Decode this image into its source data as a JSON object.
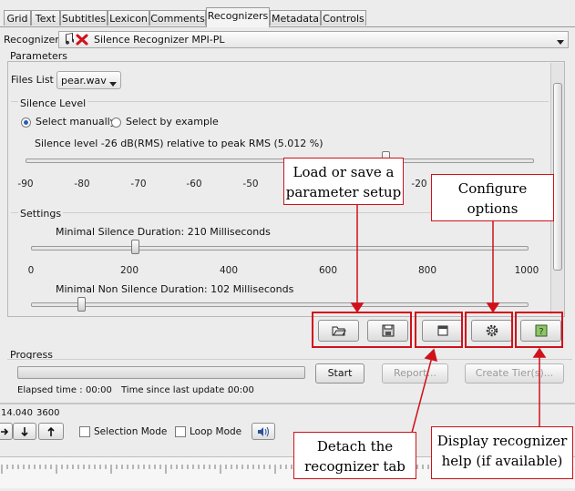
{
  "tabs": [
    "Grid",
    "Text",
    "Subtitles",
    "Lexicon",
    "Comments",
    "Recognizers",
    "Metadata",
    "Controls"
  ],
  "recognizer": {
    "label": "Recognizer:",
    "selected": "Silence Recognizer MPI-PL"
  },
  "parameters": {
    "title": "Parameters",
    "files_label": "Files List :",
    "files_value": "pear.wav",
    "silence_level": {
      "title": "Silence Level",
      "option_manual": "Select manually",
      "option_example": "Select by example",
      "selected": "manual",
      "text": "Silence level -26 dB(RMS) relative to peak RMS (5.012 %)",
      "ticks": [
        "-90",
        "-80",
        "-70",
        "-60",
        "-50",
        "-20"
      ],
      "value_db": -26
    },
    "settings": {
      "title": "Settings",
      "min_silence_label": "Minimal Silence Duration: 210 Milliseconds",
      "min_silence_value": 210,
      "min_nonsilence_label": "Minimal Non Silence Duration: 102 Milliseconds",
      "min_nonsilence_value": 102,
      "ticks": [
        "0",
        "200",
        "400",
        "600",
        "800",
        "1000"
      ],
      "max": 1000
    }
  },
  "progress": {
    "title": "Progress",
    "start": "Start",
    "report": "Report...",
    "create_tiers": "Create Tier(s)...",
    "elapsed_label": "Elapsed time :",
    "elapsed_value": "00:00",
    "since_label": "Time since last update :",
    "since_value": "00:00",
    "percent": 0
  },
  "timeline": {
    "time_a": "14.040",
    "time_b": "3600",
    "selection_mode": "Selection Mode",
    "loop_mode": "Loop Mode"
  },
  "callouts": {
    "load_save": "Load or save a parameter setup",
    "configure": "Configure options",
    "detach": "Detach the recognizer tab",
    "help": "Display recognizer help (if available)"
  },
  "colors": {
    "annotation_red": "#d0111a",
    "panel": "#ececec"
  }
}
